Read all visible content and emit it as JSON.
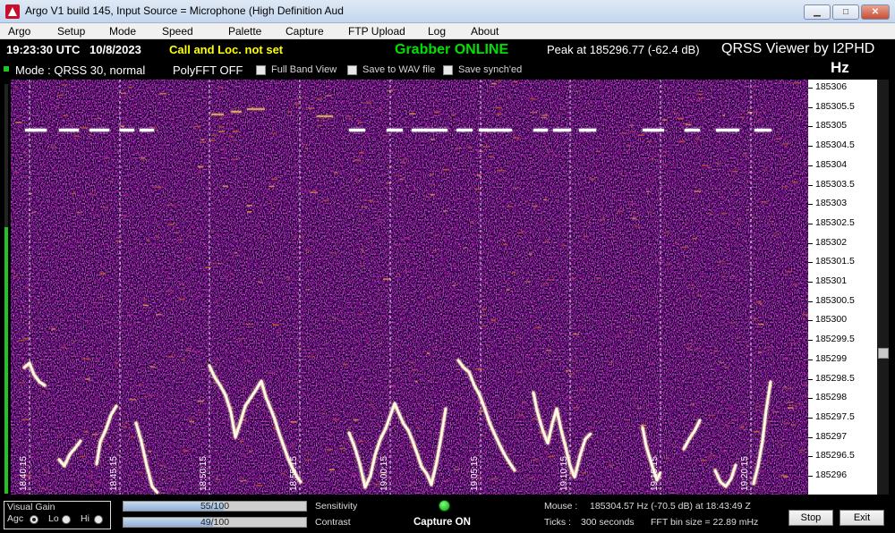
{
  "window": {
    "title": "Argo V1 build 145, Input Source = Microphone (High Definition Aud",
    "minimize_glyph": "▁",
    "maximize_glyph": "□",
    "close_glyph": "✕"
  },
  "menu": [
    "Argo",
    "Setup",
    "Mode",
    "Speed",
    "Palette",
    "Capture",
    "FTP Upload",
    "Log",
    "About"
  ],
  "status": {
    "time": "19:23:30 UTC",
    "date": "10/8/2023",
    "call_loc": "Call and Loc. not set",
    "grabber": "Grabber ONLINE",
    "peak": "Peak at  185296.77 (-62.4 dB)",
    "viewer_title": "QRSS Viewer by I2PHD",
    "hz_unit": "Hz",
    "mode": "Mode : QRSS 30, normal",
    "polyfft": "PolyFFT OFF",
    "full_band": "Full Band View",
    "save_wav": "Save to WAV file",
    "save_synch": "Save synch'ed"
  },
  "colors": {
    "time": "#ffffff",
    "call_loc": "#ffff00",
    "grabber": "#00e000",
    "peak": "#ffffff",
    "waterfall_bg": "#1a1560",
    "signal_core": "#ffffff"
  },
  "frequency_scale": [
    "185306",
    "185305.5",
    "185305",
    "185304.5",
    "185304",
    "185303.5",
    "185303",
    "185302.5",
    "185302",
    "185301.5",
    "185301",
    "185300.5",
    "185300",
    "185299.5",
    "185299",
    "185298.5",
    "185298",
    "185297.5",
    "185297",
    "185296.5",
    "185296"
  ],
  "time_markers": [
    "18:40:15",
    "18:45:15",
    "18:50:15",
    "18:55:15",
    "19:00:15",
    "19:05:15",
    "19:10:15",
    "19:15:15",
    "19:20:15"
  ],
  "bottom": {
    "visual_gain": "Visual Gain",
    "agc": "Agc",
    "lo": "Lo",
    "hi": "Hi",
    "sensitivity_value": "55/100",
    "sensitivity_fraction": 0.55,
    "sensitivity_label": "Sensitivity",
    "contrast_value": "49/100",
    "contrast_fraction": 0.49,
    "contrast_label": "Contrast",
    "capture": "Capture ON",
    "mouse_label": "Mouse :",
    "mouse_value": "185304.57 Hz  (-70.5 dB) at 18:43:49 Z",
    "ticks_label": "Ticks  :",
    "ticks_value": "300 seconds",
    "fft_bin": "FFT bin size = 22.89 mHz",
    "stop": "Stop",
    "exit": "Exit"
  }
}
